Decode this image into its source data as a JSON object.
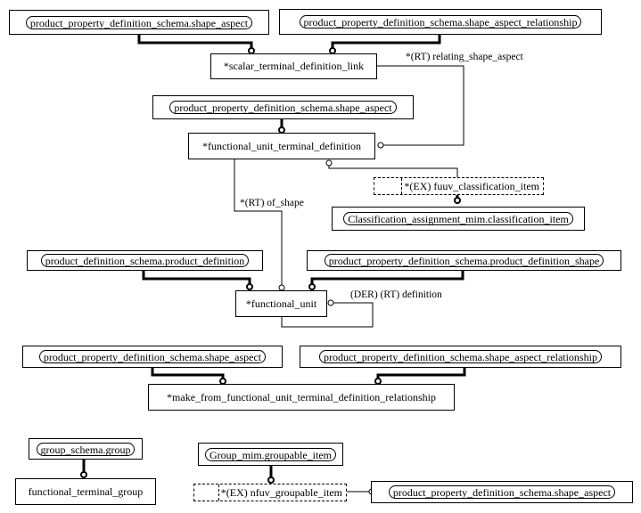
{
  "diagram": {
    "entities": {
      "sa_top": "product_property_definition_schema.shape_aspect",
      "sar_top": "product_property_definition_schema.shape_aspect_relationship",
      "scalar_link": "*scalar_terminal_definition_link",
      "sa_mid": "product_property_definition_schema.shape_aspect",
      "futd": "*functional_unit_terminal_definition",
      "fuuv_select": "*(EX) fuuv_classification_item",
      "class_item": "Classification_assignment_mim.classification_item",
      "pd": "product_definition_schema.product_definition",
      "pds": "product_property_definition_schema.product_definition_shape",
      "fu": "*functional_unit",
      "sa_low": "product_property_definition_schema.shape_aspect",
      "sar_low": "product_property_definition_schema.shape_aspect_relationship",
      "make_from": "*make_from_functional_unit_terminal_definition_relationship",
      "group": "group_schema.group",
      "ftg": "functional_terminal_group",
      "groupable": "Group_mim.groupable_item",
      "nfuv_select": "*(EX) nfuv_groupable_item",
      "sa_bottom": "product_property_definition_schema.shape_aspect"
    },
    "relations": {
      "relating_shape_aspect": "*(RT) relating_shape_aspect",
      "of_shape": "*(RT) of_shape",
      "definition": "(DER) (RT) definition"
    }
  }
}
